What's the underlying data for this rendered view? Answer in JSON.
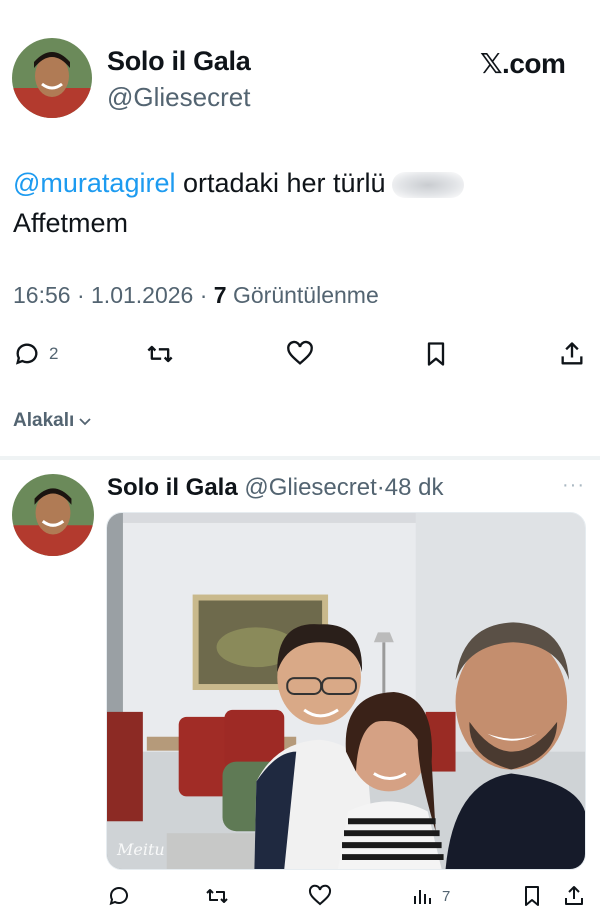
{
  "tweet": {
    "display_name": "Solo il Gala",
    "handle": "@Gliesecret",
    "site": "𝕏.com",
    "mention": "@muratagirel",
    "text_after_mention": " ortadaki her türlü",
    "text_line2": "Affetmem",
    "time": "16:56",
    "date": "1.01.2026",
    "views_count": "7",
    "views_label": "Görüntülenme",
    "reply_count": "2"
  },
  "related": {
    "label": "Alakalı"
  },
  "reply": {
    "display_name": "Solo il Gala",
    "handle": "@Gliesecret",
    "age": "48 dk",
    "more": "···",
    "watermark": "Meitu",
    "views_count": "7"
  },
  "icons": {
    "reply": "speech-bubble-icon",
    "retweet": "retweet-icon",
    "like": "heart-icon",
    "bookmark": "bookmark-icon",
    "share": "share-icon",
    "views": "bar-chart-icon"
  },
  "colors": {
    "accent": "#1d9bf0",
    "muted": "#536471",
    "text": "#0f1419"
  }
}
